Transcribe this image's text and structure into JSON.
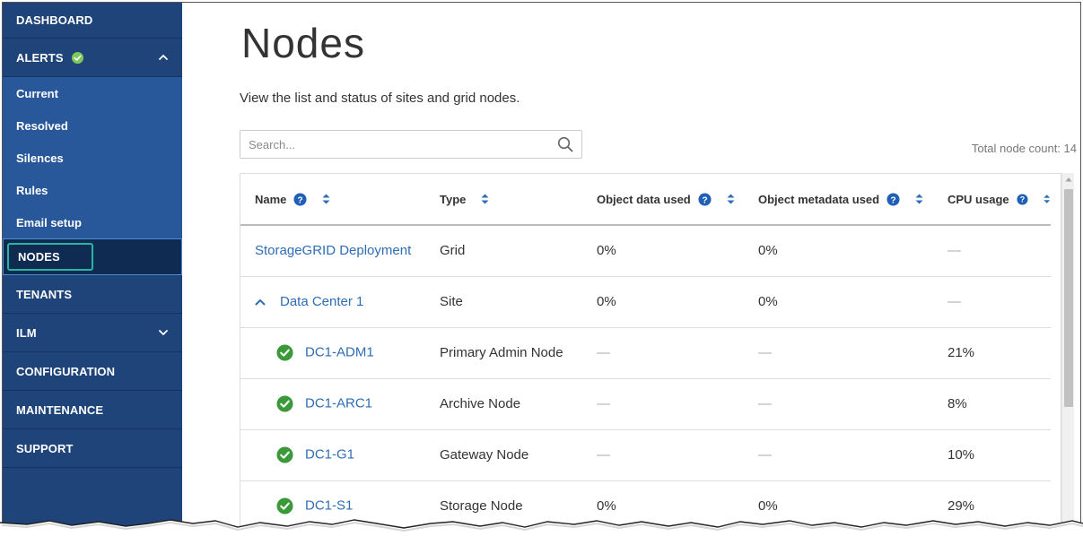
{
  "sidebar": {
    "items": [
      {
        "label": "DASHBOARD"
      },
      {
        "label": "ALERTS"
      },
      {
        "label": "NODES"
      },
      {
        "label": "TENANTS"
      },
      {
        "label": "ILM"
      },
      {
        "label": "CONFIGURATION"
      },
      {
        "label": "MAINTENANCE"
      },
      {
        "label": "SUPPORT"
      }
    ],
    "alerts_sub": [
      {
        "label": "Current"
      },
      {
        "label": "Resolved"
      },
      {
        "label": "Silences"
      },
      {
        "label": "Rules"
      },
      {
        "label": "Email setup"
      }
    ]
  },
  "page": {
    "title": "Nodes",
    "description": "View the list and status of sites and grid nodes."
  },
  "search": {
    "placeholder": "Search..."
  },
  "total_count": "Total node count: 14",
  "table": {
    "headers": {
      "name": "Name",
      "type": "Type",
      "object_data_used": "Object data used",
      "object_metadata_used": "Object metadata used",
      "cpu_usage": "CPU usage"
    },
    "rows": [
      {
        "name": "StorageGRID Deployment",
        "type": "Grid",
        "object_data_used": "0%",
        "object_metadata_used": "0%",
        "cpu_usage": "—"
      },
      {
        "name": "Data Center 1",
        "type": "Site",
        "object_data_used": "0%",
        "object_metadata_used": "0%",
        "cpu_usage": "—"
      },
      {
        "name": "DC1-ADM1",
        "type": "Primary Admin Node",
        "object_data_used": "—",
        "object_metadata_used": "—",
        "cpu_usage": "21%"
      },
      {
        "name": "DC1-ARC1",
        "type": "Archive Node",
        "object_data_used": "—",
        "object_metadata_used": "—",
        "cpu_usage": "8%"
      },
      {
        "name": "DC1-G1",
        "type": "Gateway Node",
        "object_data_used": "—",
        "object_metadata_used": "—",
        "cpu_usage": "10%"
      },
      {
        "name": "DC1-S1",
        "type": "Storage Node",
        "object_data_used": "0%",
        "object_metadata_used": "0%",
        "cpu_usage": "29%"
      }
    ]
  },
  "colors": {
    "sidebar_bg": "#1e4479",
    "sidebar_sub_bg": "#28579a",
    "link": "#2e6db4",
    "status_ok": "#3a9a3a",
    "selected_outline": "#29b5a6"
  }
}
